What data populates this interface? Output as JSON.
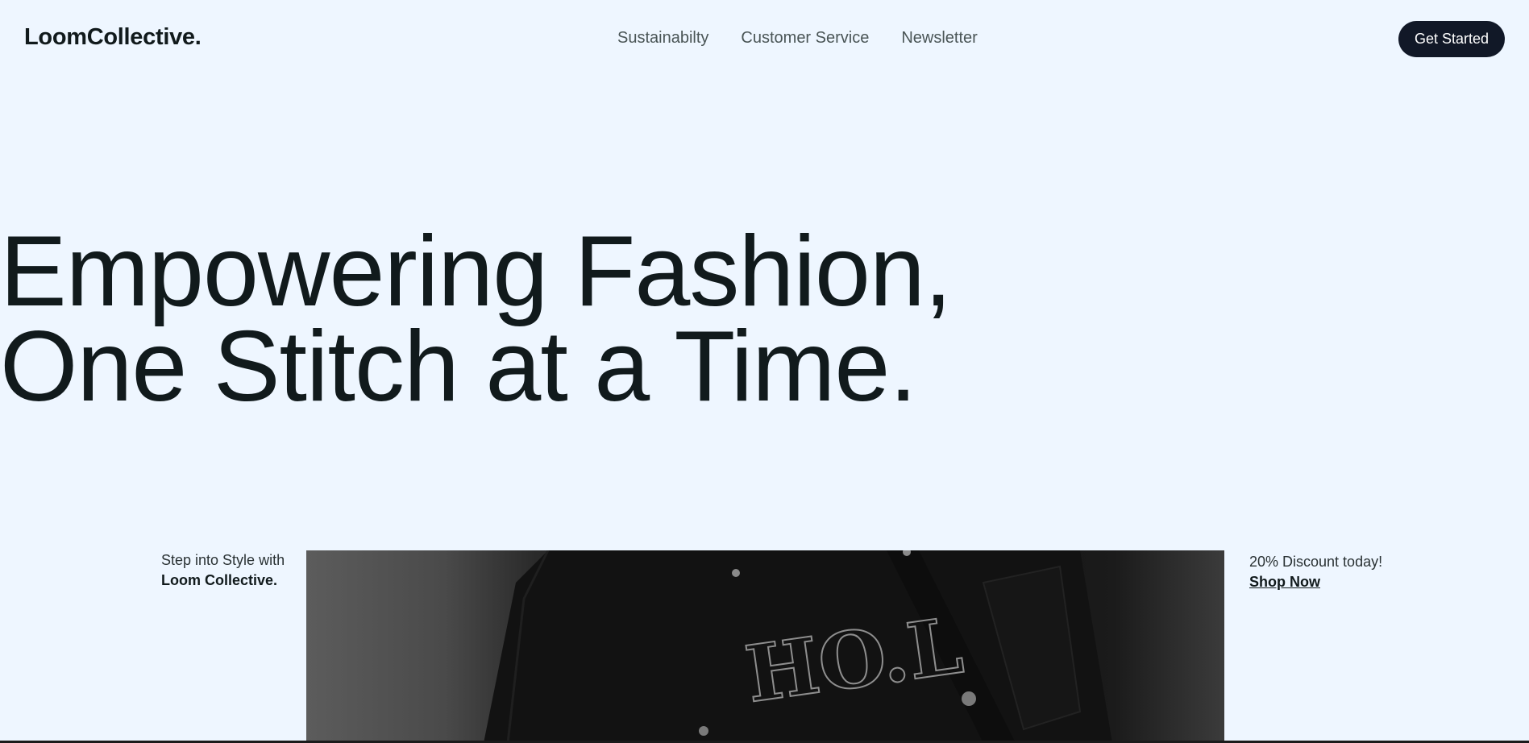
{
  "header": {
    "logo": "LoomCollective.",
    "nav": [
      {
        "label": "Sustainabilty"
      },
      {
        "label": "Customer Service"
      },
      {
        "label": "Newsletter"
      }
    ],
    "cta_label": "Get Started"
  },
  "hero": {
    "line1": "Empowering Fashion,",
    "line2": "One Stitch at a Time."
  },
  "promo_left": {
    "line1": "Step into Style with",
    "line2": "Loom Collective."
  },
  "promo_right": {
    "line1": "20% Discount today!",
    "link": "Shop Now"
  },
  "photo": {
    "printed_text": "HO.L"
  },
  "colors": {
    "background": "#eef6ff",
    "text": "#111a1c",
    "button": "#111827"
  }
}
